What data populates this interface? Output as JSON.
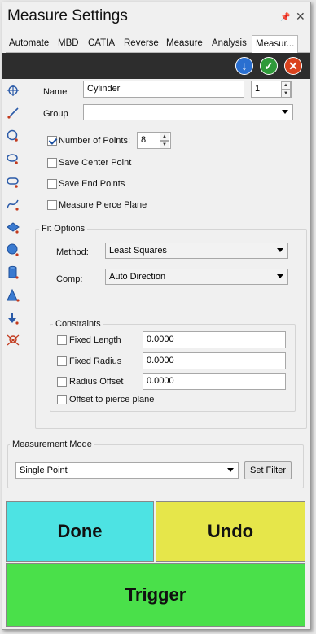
{
  "window": {
    "title": "Measure Settings",
    "pin_icon": "pin-icon",
    "close_icon": "close-icon"
  },
  "tabs": [
    {
      "label": "Automate",
      "active": false
    },
    {
      "label": "MBD",
      "active": false
    },
    {
      "label": "CATIA",
      "active": false
    },
    {
      "label": "Reverse",
      "active": false
    },
    {
      "label": "Measure",
      "active": false
    },
    {
      "label": "Analysis",
      "active": false
    },
    {
      "label": "Measur...",
      "active": true
    }
  ],
  "toolbar": {
    "buttons": [
      {
        "icon": "download-arrow-icon",
        "color": "#2a6fd0",
        "glyph": "↓"
      },
      {
        "icon": "checkmark-icon",
        "color": "#2f9a3a",
        "glyph": "✓"
      },
      {
        "icon": "cancel-icon",
        "color": "#d9431e",
        "glyph": "✕"
      }
    ]
  },
  "side_icons": [
    "point-feature-icon",
    "line-feature-icon",
    "circle-feature-icon",
    "ellipse-feature-icon",
    "slot-feature-icon",
    "curve-feature-icon",
    "plane-feature-icon",
    "sphere-feature-icon",
    "cylinder-feature-icon",
    "cone-feature-icon",
    "vector-point-icon",
    "intersection-feature-icon"
  ],
  "form": {
    "name_label": "Name",
    "name_value": "Cylinder",
    "name_index": "1",
    "group_label": "Group",
    "group_value": "",
    "num_points_label": "Number of Points:",
    "num_points_checked": true,
    "num_points_value": "8",
    "save_center_label": "Save Center Point",
    "save_center_checked": false,
    "save_end_label": "Save End Points",
    "save_end_checked": false,
    "pierce_label": "Measure Pierce Plane",
    "pierce_checked": false
  },
  "fit_options": {
    "title": "Fit Options",
    "method_label": "Method:",
    "method_value": "Least Squares",
    "comp_label": "Comp:",
    "comp_value": "Auto Direction"
  },
  "constraints": {
    "title": "Constraints",
    "fixed_length_label": "Fixed Length",
    "fixed_length_value": "0.0000",
    "fixed_radius_label": "Fixed Radius",
    "fixed_radius_value": "0.0000",
    "radius_offset_label": "Radius Offset",
    "radius_offset_value": "0.0000",
    "offset_pierce_label": "Offset to pierce plane"
  },
  "measurement_mode": {
    "title": "Measurement Mode",
    "value": "Single Point",
    "filter_button": "Set Filter"
  },
  "actions": {
    "done": "Done",
    "undo": "Undo",
    "trigger": "Trigger",
    "done_color": "#4de3e3",
    "undo_color": "#e6e64a",
    "trigger_color": "#4ae04a"
  }
}
